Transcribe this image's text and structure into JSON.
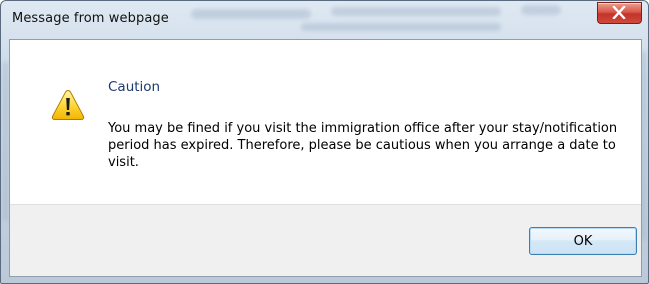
{
  "window": {
    "title": "Message from webpage",
    "close_icon": "close-x-icon"
  },
  "dialog": {
    "icon": "warning-icon",
    "caption": "Caution",
    "message": "You may be fined if you visit the immigration office after your stay/notification period has expired. Therefore, please be cautious when you arrange a date to visit."
  },
  "buttons": {
    "ok_label": "OK"
  },
  "colors": {
    "caption": "#1e3b6e",
    "close_button": "#c2342a",
    "ok_border": "#3c7fb1",
    "footer_bg": "#f0f0f0"
  }
}
